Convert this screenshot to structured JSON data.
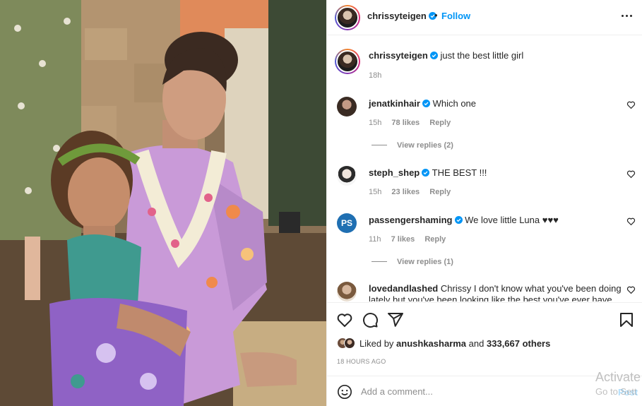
{
  "post": {
    "author": "chrissyteigen",
    "follow_label": "Follow",
    "dot": "•",
    "caption": "just the best little girl",
    "caption_time": "18h",
    "likes_prefix": "Liked by",
    "likes_user": "anushkasharma",
    "likes_and": "and",
    "likes_others": "333,667 others",
    "time_ago": "18 HOURS AGO"
  },
  "comments": [
    {
      "user": "jenatkinhair",
      "text": "Which one",
      "time": "15h",
      "likes": "78 likes",
      "reply": "Reply",
      "view_replies": "View replies (2)"
    },
    {
      "user": "steph_shep",
      "text": "THE BEST !!!",
      "time": "15h",
      "likes": "23 likes",
      "reply": "Reply"
    },
    {
      "user": "passengershaming",
      "text": "We love little Luna ♥♥♥",
      "time": "11h",
      "likes": "7 likes",
      "reply": "Reply",
      "view_replies": "View replies (1)"
    },
    {
      "user": "lovedandlashed",
      "text": "Chrissy I don't know what you've been doing lately but you've been looking like the best you've ever have"
    }
  ],
  "add_comment": {
    "placeholder": "Add a comment...",
    "post_label": "Post"
  },
  "watermark": {
    "line1": "Activate",
    "line2": "Go to Sett"
  },
  "colors": {
    "accent": "#0095f6",
    "verified": "#0095f6",
    "muted": "#8e8e8e"
  },
  "icons": [
    "verified-badge-icon",
    "more-options-icon",
    "heart-icon",
    "comment-icon",
    "share-icon",
    "bookmark-icon",
    "emoji-icon"
  ]
}
